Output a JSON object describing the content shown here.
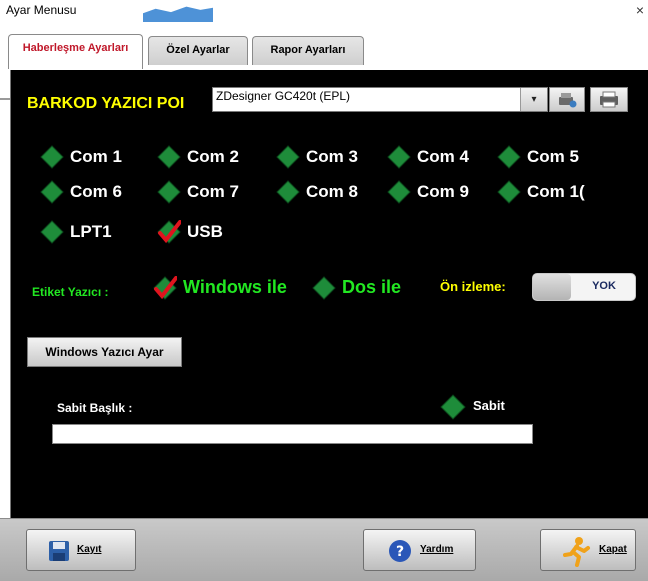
{
  "window": {
    "title": "Ayar Menusu",
    "close_glyph": "×"
  },
  "tabs": [
    {
      "label": "Haberleşme Ayarları",
      "active": true
    },
    {
      "label": "Özel Ayarlar",
      "active": false
    },
    {
      "label": "Rapor Ayarları",
      "active": false
    }
  ],
  "barcode": {
    "label": "BARKOD YAZICI POI",
    "printer_value": "ZDesigner GC420t (EPL)",
    "dropdown_glyph": "▾"
  },
  "ports": {
    "row1": [
      "Com 1",
      "Com 2",
      "Com 3",
      "Com 4",
      "Com 5"
    ],
    "row2": [
      "Com 6",
      "Com 7",
      "Com 8",
      "Com 9",
      "Com 1("
    ],
    "row3": [
      "LPT1",
      "USB"
    ],
    "selected": "USB"
  },
  "label_printer": {
    "label": "Etiket Yazıcı :",
    "windows_option": "Windows ile",
    "dos_option": "Dos ile",
    "selected": "Windows ile"
  },
  "preview": {
    "label": "Ön izleme:",
    "value": "YOK"
  },
  "windows_printer_button": "Windows Yazıcı Ayar",
  "header": {
    "label": "Sabit Başlık :",
    "fixed_label": "Sabit",
    "value": ""
  },
  "footer": {
    "save": "Kayıt",
    "help": "Yardım",
    "close": "Kapat"
  },
  "colors": {
    "background": "#000000",
    "yellow_text": "#ffff00",
    "green_text": "#22e822",
    "radio_green": "#1e8c3a",
    "check_red": "#e0141e",
    "active_tab_text": "#c0182a"
  }
}
